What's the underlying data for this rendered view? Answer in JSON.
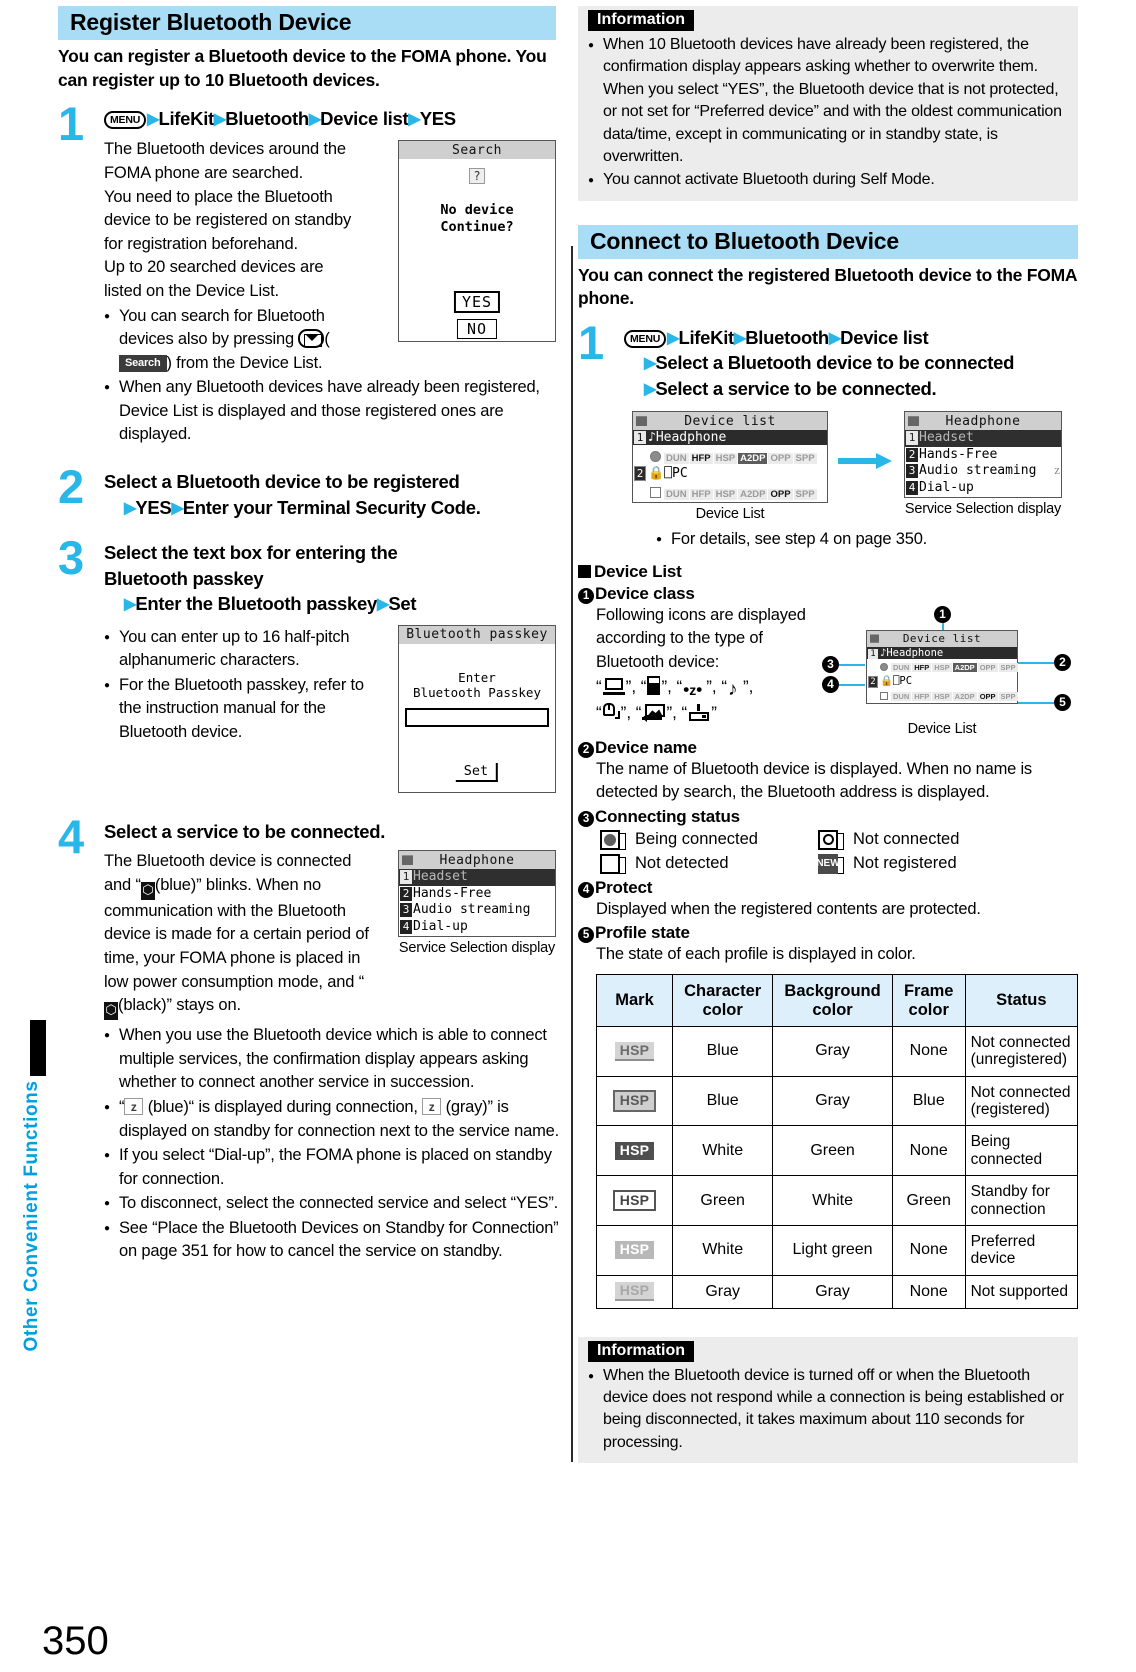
{
  "page": {
    "number": "350",
    "sidebar_label": "Other Convenient Functions"
  },
  "left_column": {
    "section_title": "Register Bluetooth Device",
    "lead": "You can register a Bluetooth device to the FOMA phone. You can register up to 10 Bluetooth devices.",
    "step1": {
      "num": "1",
      "menu_key": "MENU",
      "path": [
        "LifeKit",
        "Bluetooth",
        "Device list",
        "YES"
      ],
      "body": "The Bluetooth devices around the FOMA phone are searched.\nYou need to place the Bluetooth device to be registered on standby for registration beforehand.\nUp to 20 searched devices are listed on the Device List.",
      "body_lines": [
        "The Bluetooth devices around the",
        "FOMA phone are searched.",
        "You need to place the Bluetooth",
        "device to be registered on standby",
        "for registration beforehand.",
        "Up to 20 searched devices are",
        "listed on the Device List."
      ],
      "bullets": [
        "You can search for Bluetooth devices also by pressing  (  ) from the Device List.",
        "When any Bluetooth devices have already been registered, Device List is displayed and those registered ones are displayed."
      ],
      "bullet1_pre": "You can search for Bluetooth devices also by pressing ",
      "bullet1_mid": "(",
      "bullet1_key": "Search",
      "bullet1_post": ") from the Device List.",
      "screen": {
        "title": "Search",
        "qmark": "?",
        "message_line1": "No device",
        "message_line2": "Continue?",
        "yes": "YES",
        "no": "NO"
      }
    },
    "step2": {
      "num": "2",
      "title_line1": "Select a Bluetooth device to be registered",
      "title_line2_a": "YES",
      "title_line2_b": "Enter your Terminal Security Code."
    },
    "step3": {
      "num": "3",
      "title_line1": "Select the text box for entering the",
      "title_line2": "Bluetooth passkey",
      "title_line3_a": "Enter the Bluetooth passkey",
      "title_line3_b": "Set",
      "bullets": [
        "You can enter up to 16 half-pitch alphanumeric characters.",
        "For the Bluetooth passkey, refer to the instruction manual for the Bluetooth device."
      ],
      "screen": {
        "title": "Bluetooth passkey",
        "line1": "Enter",
        "line2": "Bluetooth Passkey",
        "set": "Set"
      }
    },
    "step4": {
      "num": "4",
      "title": "Select a service to be connected.",
      "body_pre": "The Bluetooth device is connected and “",
      "body_mid": "(blue)” blinks. When no communication with the Bluetooth device is made for a certain period of time, your FOMA phone is placed in low power consumption mode, and “",
      "body_post": "(black)” stays on.",
      "screen": {
        "title": "Headphone",
        "items": [
          "Headset",
          "Hands-Free",
          "Audio streaming",
          "Dial-up"
        ],
        "caption": "Service Selection display"
      },
      "bullets": [
        "When you use the Bluetooth device which is able to connect multiple services, the confirmation display appears asking whether to connect another service in succession.",
        "“ (blue)“ is displayed during connection,  (gray)” is displayed on standby for connection next to the service name.",
        "If you select “Dial-up”, the FOMA phone is placed on standby for connection.",
        "To disconnect, select the connected service and select “YES”.",
        "See “Place the Bluetooth Devices on Standby for Connection” on page 351 for how to cancel the service on standby."
      ],
      "bullet2_a": "“",
      "bullet2_b": "(blue)“ is displayed during connection,",
      "bullet2_c": "(gray)”",
      "bullet2_d": "is displayed on standby for connection next to the service name."
    }
  },
  "right_column": {
    "info_top": {
      "tag": "Information",
      "bullets": [
        "When 10 Bluetooth devices have already been registered, the confirmation display appears asking whether to overwrite them. When you select “YES”, the Bluetooth device that is not protected, or not set for “Preferred device” and with the oldest communication data/time, except in communicating or in standby state, is overwritten.",
        "You cannot activate Bluetooth during Self Mode."
      ]
    },
    "section_title": "Connect to Bluetooth Device",
    "lead": "You can connect the registered Bluetooth device to the FOMA phone.",
    "step1": {
      "num": "1",
      "menu_key": "MENU",
      "path": [
        "LifeKit",
        "Bluetooth",
        "Device list"
      ],
      "line2": "Select a Bluetooth device to be connected",
      "line3": "Select a service to be connected.",
      "device_list_screen": {
        "title": "Device list",
        "row1_index": "1",
        "row1_name": "Headphone",
        "row1_profiles": [
          "DUN",
          "HFP",
          "HSP",
          "A2DP",
          "OPP",
          "SPP"
        ],
        "row1_profile_active": "A2DP",
        "row2_index": "2",
        "row2_name": "PC",
        "row2_profiles": [
          "DUN",
          "HFP",
          "HSP",
          "A2DP",
          "OPP",
          "SPP"
        ],
        "row2_profile_active": "OPP",
        "caption": "Device List"
      },
      "service_screen": {
        "title": "Headphone",
        "items": [
          "Headset",
          "Hands-Free",
          "Audio streaming",
          "Dial-up"
        ],
        "caption": "Service Selection display"
      },
      "bullet": "For details, see step 4 on page 350."
    },
    "device_list_heading": "Device List",
    "items": {
      "item1": {
        "num": "1",
        "title": "Device class",
        "body": "Following icons are displayed according to the type of Bluetooth device:",
        "glyph_names": [
          "pc-icon",
          "mobile-phone-icon",
          "modem-icon",
          "audio-icon",
          "mouse-icon",
          "image-icon",
          "printer-icon"
        ]
      },
      "item2": {
        "num": "2",
        "title": "Device name",
        "body": "The name of Bluetooth device is displayed. When no name is detected by search, the Bluetooth address is displayed."
      },
      "item3": {
        "num": "3",
        "title": "Connecting status",
        "legend": [
          {
            "icon": "filled-circle-icon",
            "label": "Being connected"
          },
          {
            "icon": "open-circle-icon",
            "label": "Not connected"
          },
          {
            "icon": "empty-box-icon",
            "label": "Not detected"
          },
          {
            "icon": "new-tag-icon",
            "label": "Not registered",
            "tag_text": "NEW"
          }
        ]
      },
      "item4": {
        "num": "4",
        "title": "Protect",
        "body": "Displayed when the registered contents are protected."
      },
      "item5": {
        "num": "5",
        "title": "Profile state",
        "body": "The state of each profile is displayed in color."
      }
    },
    "callout_caption": "Device List",
    "profile_table": {
      "headers": [
        "Mark",
        "Character color",
        "Background color",
        "Frame color",
        "Status"
      ],
      "mark_label": "HSP",
      "rows": [
        {
          "mark_style": "v1",
          "character": "Blue",
          "background": "Gray",
          "frame": "None",
          "status": "Not connected (unregistered)",
          "status_l1": "Not connected",
          "status_l2": "(unregistered)"
        },
        {
          "mark_style": "v2",
          "character": "Blue",
          "background": "Gray",
          "frame": "Blue",
          "status": "Not connected (registered)",
          "status_l1": "Not connected",
          "status_l2": "(registered)"
        },
        {
          "mark_style": "v3",
          "character": "White",
          "background": "Green",
          "frame": "None",
          "status": "Being connected",
          "status_l1": "Being connected",
          "status_l2": ""
        },
        {
          "mark_style": "v4",
          "character": "Green",
          "background": "White",
          "frame": "Green",
          "status": "Standby for connection",
          "status_l1": "Standby for",
          "status_l2": "connection"
        },
        {
          "mark_style": "v5",
          "character": "White",
          "background": "Light green",
          "frame": "None",
          "status": "Preferred device",
          "status_l1": "Preferred device",
          "status_l2": ""
        },
        {
          "mark_style": "v6",
          "character": "Gray",
          "background": "Gray",
          "frame": "None",
          "status": "Not supported",
          "status_l1": "Not supported",
          "status_l2": ""
        }
      ]
    },
    "info_bottom": {
      "tag": "Information",
      "bullets": [
        "When the Bluetooth device is turned off or when the Bluetooth device does not respond while a connection is being established or being disconnected, it takes maximum about 110 seconds for processing."
      ]
    }
  },
  "colors": {
    "heading_band": "#a9ddf6",
    "step_number": "#29b6e8",
    "arrow": "#29b6e8",
    "table_header": "#ddeffb",
    "info_bg": "#ececec"
  }
}
